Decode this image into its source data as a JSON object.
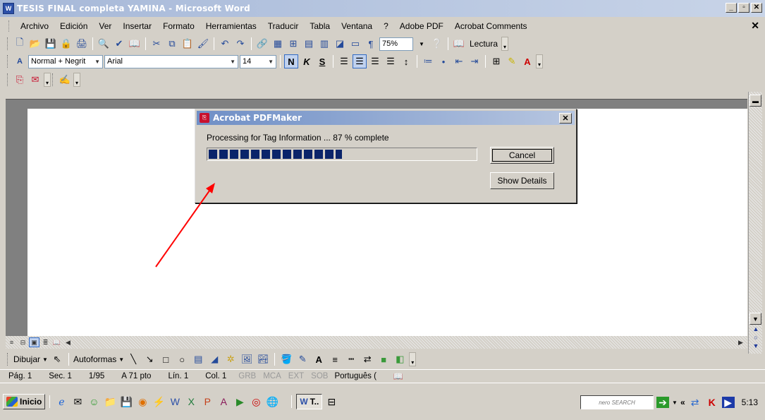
{
  "window": {
    "title": "TESIS FINAL completa YAMINA - Microsoft Word",
    "app_icon": "W"
  },
  "menu": [
    "Archivo",
    "Edición",
    "Ver",
    "Insertar",
    "Formato",
    "Herramientas",
    "Traducir",
    "Tabla",
    "Ventana",
    "?",
    "Adobe PDF",
    "Acrobat Comments"
  ],
  "standard_toolbar": {
    "zoom": "75%",
    "reading": "Lectura"
  },
  "format_toolbar": {
    "style": "Normal + Negrit",
    "font": "Arial",
    "size": "14",
    "bold": "N",
    "italic": "K",
    "underline": "S"
  },
  "dialog": {
    "title": "Acrobat PDFMaker",
    "status": "Processing for Tag Information ... 87 % complete",
    "progress_fraction": 0.5,
    "cancel_label": "Cancel",
    "details_label": "Show Details"
  },
  "drawing_toolbar": {
    "draw": "Dibujar",
    "autoshapes": "Autoformas"
  },
  "statusbar": {
    "page": "Pág. 1",
    "section": "Sec. 1",
    "pages": "1/95",
    "position": "A 71 pto",
    "line": "Lín. 1",
    "column": "Col. 1",
    "modes": [
      "GRB",
      "MCA",
      "EXT",
      "SOB"
    ],
    "language": "Português ("
  },
  "taskbar": {
    "start": "Inicio",
    "task_label": "T..",
    "tray_search": "nero SEARCH",
    "clock": "5:13"
  },
  "colors": {
    "progress": "#0a246a",
    "arrow": "#ff0000",
    "title_gradient_start": "#a6b8d8"
  }
}
